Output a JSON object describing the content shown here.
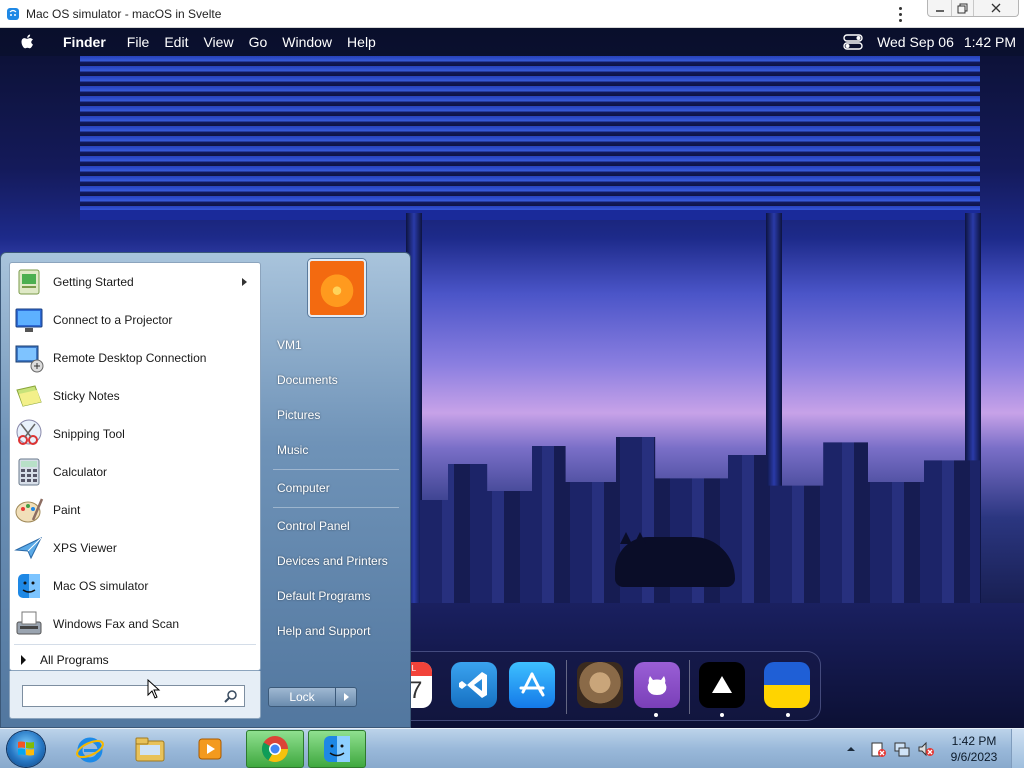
{
  "window": {
    "title": "Mac OS simulator - macOS in Svelte"
  },
  "menubar": {
    "app_name": "Finder",
    "menus": [
      "File",
      "Edit",
      "View",
      "Go",
      "Window",
      "Help"
    ],
    "date": "Wed Sep 06",
    "time": "1:42 PM",
    "icons": [
      "apple-icon",
      "control-center-icon"
    ]
  },
  "dock": {
    "items": [
      {
        "name": "calendar",
        "label": "JUL",
        "day": "17",
        "running": false
      },
      {
        "name": "vscode",
        "running": true
      },
      {
        "name": "app-store",
        "running": false
      },
      {
        "name": "purrcy",
        "running": false
      },
      {
        "name": "github",
        "running": true
      },
      {
        "name": "vercel",
        "running": true
      },
      {
        "name": "ukraine",
        "running": true
      }
    ]
  },
  "start_menu": {
    "programs": [
      {
        "label": "Getting Started",
        "icon": "getting-started-icon",
        "submenu": true
      },
      {
        "label": "Connect to a Projector",
        "icon": "projector-icon",
        "submenu": false
      },
      {
        "label": "Remote Desktop Connection",
        "icon": "remote-desktop-icon",
        "submenu": false
      },
      {
        "label": "Sticky Notes",
        "icon": "sticky-notes-icon",
        "submenu": false
      },
      {
        "label": "Snipping Tool",
        "icon": "snipping-tool-icon",
        "submenu": false
      },
      {
        "label": "Calculator",
        "icon": "calculator-icon",
        "submenu": false
      },
      {
        "label": "Paint",
        "icon": "paint-icon",
        "submenu": false
      },
      {
        "label": "XPS Viewer",
        "icon": "xps-viewer-icon",
        "submenu": false
      },
      {
        "label": "Mac OS simulator",
        "icon": "mac-os-simulator-icon",
        "submenu": false
      },
      {
        "label": "Windows Fax and Scan",
        "icon": "fax-scan-icon",
        "submenu": false
      }
    ],
    "all_programs": "All Programs",
    "search_placeholder": "",
    "right_pane": {
      "user": "VM1",
      "group1": [
        "Documents",
        "Pictures",
        "Music"
      ],
      "group2": [
        "Computer"
      ],
      "group3": [
        "Control Panel",
        "Devices and Printers",
        "Default Programs",
        "Help and Support"
      ]
    },
    "lock_label": "Lock"
  },
  "taskbar": {
    "pinned": [
      {
        "name": "internet-explorer",
        "active": false
      },
      {
        "name": "file-explorer",
        "active": false
      },
      {
        "name": "media-player",
        "active": false
      },
      {
        "name": "chrome",
        "active": true
      },
      {
        "name": "finder",
        "active": true
      }
    ],
    "clock_time": "1:42 PM",
    "clock_date": "9/6/2023",
    "tray_icons": [
      "show-hidden-icons",
      "action-center-icon",
      "network-icon",
      "volume-muted-icon"
    ]
  },
  "colors": {
    "menubar_text": "#ffffff",
    "start_menu_bg": "#6f93b8",
    "taskbar_bg": "#9ab9da",
    "active_task": "#3fa83f"
  }
}
